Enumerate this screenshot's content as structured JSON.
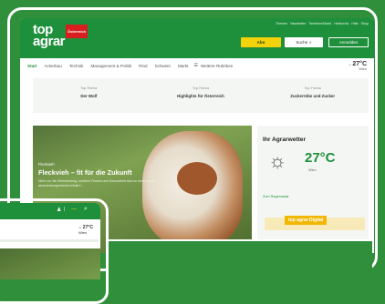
{
  "brand": {
    "logo_line1": "top",
    "logo_line2": "agrar",
    "region_badge": "Österreich"
  },
  "header": {
    "top_links": [
      "Themen",
      "Newsletter",
      "Tierbörse/Markt",
      "Heftarchiv",
      "Hilfe",
      "Shop"
    ],
    "abo_label": "Abo",
    "search_label": "Suche",
    "login_label": "Anmelden"
  },
  "nav": {
    "items": [
      "Start",
      "Ackerbau",
      "Technik",
      "Management & Politik",
      "Rind",
      "Schwein",
      "Markt"
    ],
    "more_label": "Weitere Rubriken"
  },
  "weather_mini": {
    "temp": "27°C",
    "location": "Wien"
  },
  "topics": [
    {
      "kicker": "Top-Thema",
      "title": "Der Wolf"
    },
    {
      "kicker": "Top-Thema",
      "title": "Highlights für Österreich"
    },
    {
      "kicker": "Top-Thema",
      "title": "Zuckerrübe und Zucker"
    }
  ],
  "hero": {
    "kicker": "Fleckvieh",
    "headline": "Fleckvieh – fit für die Zukunft",
    "teaser": "Nicht nur die Milchleistung, sondern Fitness und Gesundheit sind zu einem sehr abwechslungsreichen Inhalt f..."
  },
  "weather_box": {
    "heading": "Ihr Agrarwetter",
    "temp": "27°C",
    "location": "Wien",
    "link": "Zum Regenradar"
  },
  "promo": {
    "label": "top agrar Digital"
  },
  "phone": {
    "temp": "27°C",
    "location": "Wien"
  },
  "colors": {
    "brand_green": "#1e8f3b",
    "accent_yellow": "#f2d20a",
    "frame_green": "#2f8f3a"
  }
}
